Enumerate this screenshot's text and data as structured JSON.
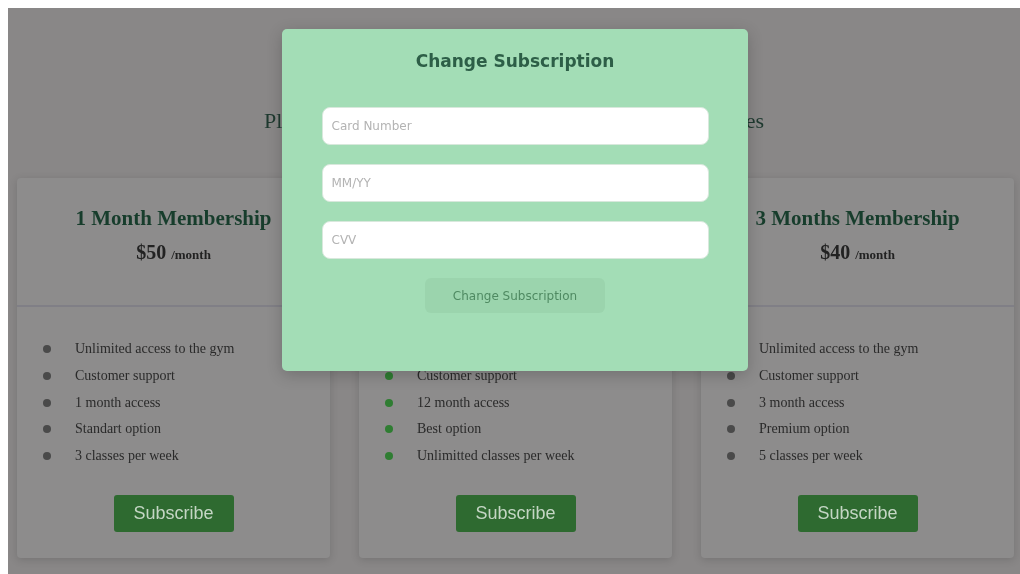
{
  "heading": {
    "left": "Pl",
    "right": "es"
  },
  "plans": [
    {
      "title": "1 Month Membership",
      "price": "$50",
      "period": "/month",
      "color": "#4a4a4a",
      "features": [
        "Unlimited access to the gym",
        "Customer support",
        "1 month access",
        "Standart option",
        "3 classes per week"
      ],
      "button": "Subscribe"
    },
    {
      "color": "#2f7d32",
      "features": [
        "Customer support",
        "12 month access",
        "Best option",
        "Unlimitted classes per week"
      ],
      "button": "Subscribe"
    },
    {
      "title": "3 Months Membership",
      "price": "$40",
      "period": "/month",
      "color": "#4a4a4a",
      "features": [
        "Unlimited access to the gym",
        "Customer support",
        "3 month access",
        "Premium option",
        "5 classes per week"
      ],
      "button": "Subscribe"
    }
  ],
  "modal": {
    "title": "Change Subscription",
    "fields": [
      {
        "placeholder": "Card Number"
      },
      {
        "placeholder": "MM/YY"
      },
      {
        "placeholder": "CVV"
      }
    ],
    "button": {
      "label": "Change Subscription",
      "disabled": true
    }
  }
}
